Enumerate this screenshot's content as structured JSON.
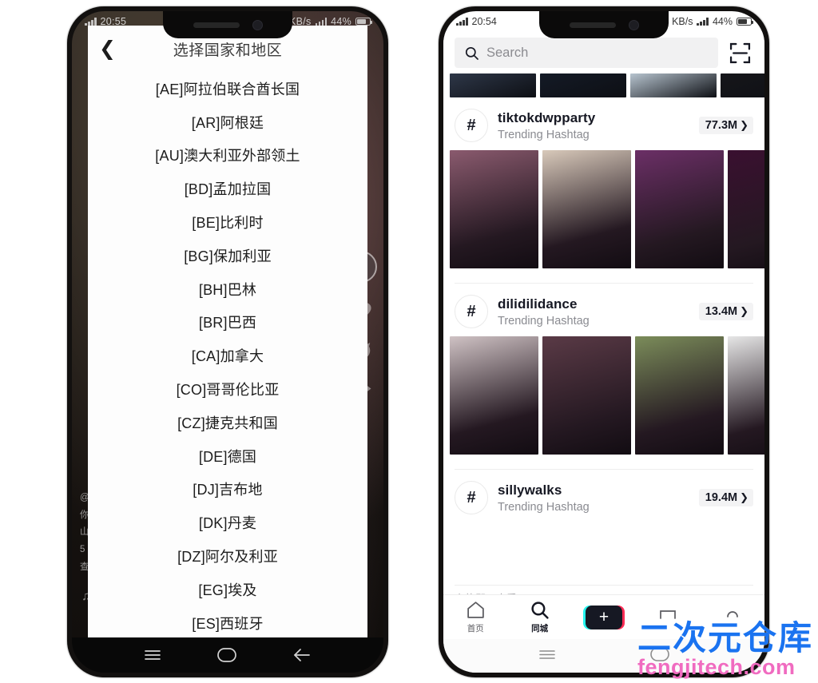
{
  "watermark": {
    "cn": "二次元仓库",
    "en": "fengjitech.com",
    "cn_color": "#1a73f0",
    "en_color": "#f06bc0"
  },
  "left_phone": {
    "status_bar": {
      "time": "20:55",
      "network": "KB/s",
      "battery": "44%"
    },
    "sheet": {
      "title": "选择国家和地区",
      "back_icon": "chevron-left-icon",
      "countries": [
        "[AE]阿拉伯联合酋长国",
        "[AR]阿根廷",
        "[AU]澳大利亚外部领土",
        "[BD]孟加拉国",
        "[BE]比利时",
        "[BG]保加利亚",
        "[BH]巴林",
        "[BR]巴西",
        "[CA]加拿大",
        "[CO]哥哥伦比亚",
        "[CZ]捷克共和国",
        "[DE]德国",
        "[DJ]吉布地",
        "[DK]丹麦",
        "[DZ]阿尔及利亚",
        "[EG]埃及",
        "[ES]西班牙"
      ]
    },
    "android_nav": [
      {
        "name": "recents-key",
        "glyph": "menu"
      },
      {
        "name": "home-key",
        "glyph": "circle"
      },
      {
        "name": "back-key",
        "glyph": "arrow-left"
      }
    ]
  },
  "right_phone": {
    "status_bar": {
      "time": "20:54",
      "network": "KB/s",
      "battery": "44%"
    },
    "search": {
      "placeholder": "Search",
      "value": "",
      "icon": "search-icon",
      "scan_icon": "scan-qr-icon"
    },
    "top_strip": [
      "#2e3748",
      "#141a26",
      "#b7c4cf",
      "#16161a"
    ],
    "hashtags": [
      {
        "name": "tiktokdwpparty",
        "subtitle": "Trending Hashtag",
        "count": "77.3M",
        "icon": "hash-icon",
        "chevron": "chevron-right-icon",
        "thumbs": [
          "#8a5a6e",
          "#d8c9ba",
          "#6b2f66",
          "#3a1030"
        ]
      },
      {
        "name": "dilidilidance",
        "subtitle": "Trending Hashtag",
        "count": "13.4M",
        "icon": "hash-icon",
        "chevron": "chevron-right-icon",
        "thumbs": [
          "#cfc2c4",
          "#5a3a46",
          "#7b8c5a",
          "#e6e6e6"
        ]
      },
      {
        "name": "sillywalks",
        "subtitle": "Trending Hashtag",
        "count": "19.4M",
        "icon": "hash-icon",
        "chevron": "chevron-right-icon",
        "thumbs": []
      }
    ],
    "partial_text": "上热即可查看",
    "tabbar": [
      {
        "label": "首页",
        "icon": "home-icon",
        "active": false
      },
      {
        "label": "同城",
        "icon": "search-icon",
        "active": true
      },
      {
        "label": "",
        "icon": "plus-icon",
        "active": false
      },
      {
        "label": "",
        "icon": "inbox-icon",
        "active": false
      },
      {
        "label": "",
        "icon": "profile-icon",
        "active": false
      }
    ],
    "plus_glyph": "+",
    "android_nav": [
      {
        "name": "recents-key",
        "glyph": "menu"
      },
      {
        "name": "home-key",
        "glyph": "circle"
      }
    ]
  }
}
